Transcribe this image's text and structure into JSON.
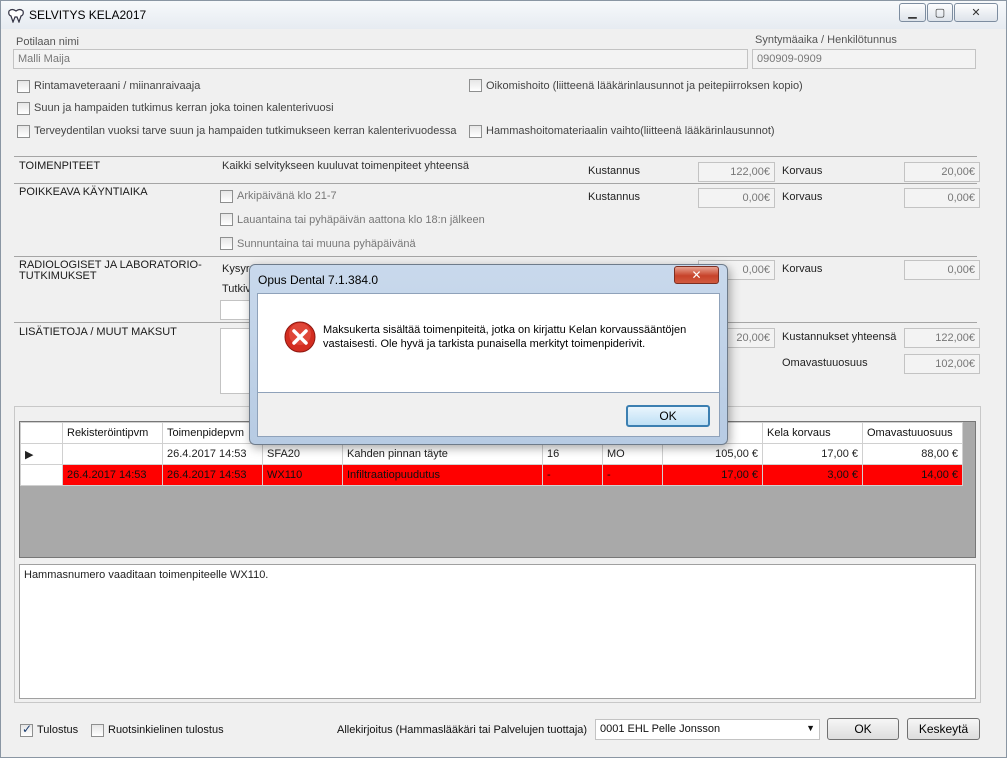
{
  "window": {
    "title": "SELVITYS KELA2017"
  },
  "patient": {
    "name_label": "Potilaan nimi",
    "name_value": "Malli Maija",
    "id_label": "Syntymäaika / Henkilötunnus",
    "id_value": "090909-0909"
  },
  "checkboxes": {
    "veteran": "Rintamaveteraani / miinanraivaaja",
    "biennial": "Suun ja hampaiden tutkimus kerran joka toinen kalenterivuosi",
    "yearly": "Terveydentilan vuoksi tarve suun ja hampaiden tutkimukseen kerran kalenterivuodessa",
    "ortho": "Oikomishoito (liitteenä lääkärinlausunnot ja peitepiirroksen kopio)",
    "material": "Hammashoitomateriaalin vaihto(liitteenä lääkärinlausunnot)"
  },
  "sections": {
    "procedures": {
      "title": "TOIMENPITEET",
      "desc": "Kaikki selvitykseen kuuluvat toimenpiteet yhteensä",
      "cost_label": "Kustannus",
      "cost": "122,00€",
      "comp_label": "Korvaus",
      "comp": "20,00€"
    },
    "unusual": {
      "title": "POIKKEAVA KÄYNTIAIKA",
      "opt1": "Arkipäivänä klo 21-7",
      "opt2": "Lauantaina tai pyhäpäivän aattona klo 18:n jälkeen",
      "opt3": "Sunnuntaina tai muuna pyhäpäivänä",
      "cost_label": "Kustannus",
      "cost": "0,00€",
      "comp_label": "Korvaus",
      "comp": "0,00€"
    },
    "radio": {
      "title_line1": "RADIOLOGISET JA LABORATORIO-",
      "title_line2": "TUTKIMUKSET",
      "partial1": "Kysyr",
      "partial2": "Tutkiv",
      "cost": "0,00€",
      "comp_label": "Korvaus",
      "comp": "0,00€"
    },
    "extra": {
      "title": "LISÄTIETOJA / MUUT MAKSUT",
      "cost": "20,00€",
      "total_label": "Kustannukset yhteensä",
      "total": "122,00€",
      "own_label": "Omavastuuosuus",
      "own": "102,00€"
    }
  },
  "table": {
    "headers": [
      "",
      "Rekisteröintipvm",
      "Toimenpidepvm",
      "",
      "",
      "",
      "",
      "",
      "Kela korvaus",
      "Omavastuuosuus"
    ],
    "rows": [
      [
        "▶",
        "26.4.2017 14:53",
        "26.4.2017 14:53",
        "SFA20",
        "Kahden pinnan täyte",
        "16",
        "MO",
        "105,00 €",
        "17,00 €",
        "88,00 €"
      ],
      [
        "",
        "26.4.2017 14:53",
        "26.4.2017 14:53",
        "WX110",
        "Infiltraatiopuudutus",
        "-",
        "-",
        "17,00 €",
        "3,00 €",
        "14,00 €"
      ]
    ]
  },
  "note": "Hammasnumero vaaditaan toimenpiteelle WX110.",
  "footer": {
    "print": "Tulostus",
    "print_sv": "Ruotsinkielinen tulostus",
    "sign_label": "Allekirjoitus (Hammaslääkäri tai Palvelujen tuottaja)",
    "sign_value": "0001 EHL Pelle Jonsson",
    "ok": "OK",
    "cancel": "Keskeytä"
  },
  "dialog": {
    "title": "Opus Dental 7.1.384.0",
    "message": "Maksukerta sisältää toimenpiteitä, jotka on kirjattu Kelan korvaussääntöjen vastaisesti. Ole hyvä ja tarkista punaisella merkityt toimenpiderivit.",
    "ok": "OK"
  },
  "colors": {
    "error_row": "#ff0000",
    "selection": "#3399ff"
  }
}
